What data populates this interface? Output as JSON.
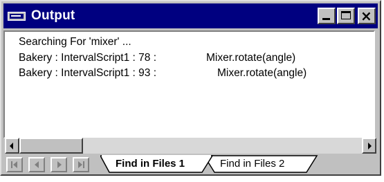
{
  "window": {
    "title": "Output",
    "icon": "output-window-icon",
    "controls": [
      "minimize-icon",
      "maximize-icon",
      "close-icon"
    ]
  },
  "output": {
    "header": "Searching For 'mixer' ...",
    "results": [
      {
        "location": "Bakery : IntervalScript1 : 78 :",
        "match": "Mixer.rotate(angle)"
      },
      {
        "location": "Bakery : IntervalScript1 : 93 :",
        "match": "Mixer.rotate(angle)"
      }
    ]
  },
  "tabs": {
    "items": [
      {
        "label": "Find in Files 1",
        "active": true
      },
      {
        "label": "Find in Files 2",
        "active": false
      }
    ],
    "nav_icons": [
      "first-tab-icon",
      "previous-tab-icon",
      "next-tab-icon",
      "last-tab-icon"
    ]
  },
  "scrollbar": {
    "icons": [
      "scroll-left-icon",
      "scroll-right-icon"
    ]
  }
}
